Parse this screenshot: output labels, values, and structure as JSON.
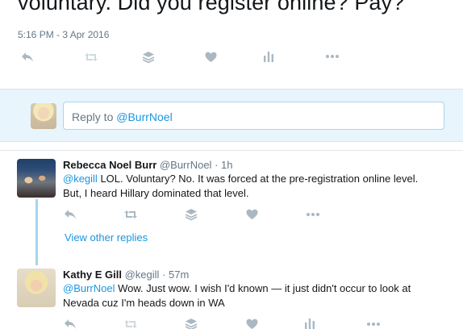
{
  "focused_tweet": {
    "text_tail": "voluntary. Did you register online? Pay?",
    "timestamp": "5:16 PM - 3 Apr 2016"
  },
  "reply_box": {
    "prefix": "Reply to ",
    "handle": "@BurrNoel"
  },
  "replies": [
    {
      "name": "Rebecca Noel Burr",
      "handle": "@BurrNoel",
      "sep": " · ",
      "time": "1h",
      "mention": "@kegill",
      "text_line1": " LOL. Voluntary? No. It was forced at the pre-registration online level.",
      "text_line2": "But, I heard Hillary dominated that level.",
      "view_other": "View other replies"
    },
    {
      "name": "Kathy E Gill",
      "handle": "@kegill",
      "sep": " · ",
      "time": "57m",
      "mention": "@BurrNoel",
      "text_line1": " Wow. Just wow. I wish I'd known — it just didn't occur to look at",
      "text_line2": "Nevada cuz I'm heads down in WA"
    }
  ],
  "icons": {
    "reply": "reply-icon",
    "retweet": "retweet-icon",
    "stack": "buffer-icon",
    "like": "heart-icon",
    "analytics": "analytics-icon",
    "more": "more-icon"
  },
  "colors": {
    "accent": "#1b95e0",
    "muted": "#aab8c2",
    "reply_bg": "#e8f5fd"
  }
}
